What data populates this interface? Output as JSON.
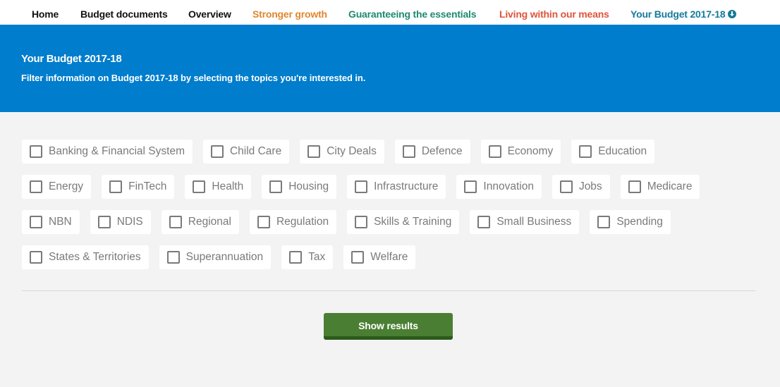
{
  "nav": {
    "items": [
      {
        "label": "Home",
        "color": "#111111"
      },
      {
        "label": "Budget documents",
        "color": "#111111"
      },
      {
        "label": "Overview",
        "color": "#111111"
      },
      {
        "label": "Stronger growth",
        "color": "#e1862c"
      },
      {
        "label": "Guaranteeing the essentials",
        "color": "#1e8a6e"
      },
      {
        "label": "Living within our means",
        "color": "#e0533a"
      },
      {
        "label": "Your Budget 2017-18",
        "color": "#157b9a",
        "icon": "download-circle-icon"
      }
    ]
  },
  "hero": {
    "title": "Your Budget 2017-18",
    "subtitle": "Filter information on Budget 2017-18 by selecting the topics you're interested in.",
    "background": "#007dcc"
  },
  "topics": {
    "rows": [
      [
        {
          "label": "Banking & Financial System",
          "checked": false
        },
        {
          "label": "Child Care",
          "checked": false
        },
        {
          "label": "City Deals",
          "checked": false
        },
        {
          "label": "Defence",
          "checked": false
        },
        {
          "label": "Economy",
          "checked": false
        },
        {
          "label": "Education",
          "checked": false
        }
      ],
      [
        {
          "label": "Energy",
          "checked": false
        },
        {
          "label": "FinTech",
          "checked": false
        },
        {
          "label": "Health",
          "checked": false
        },
        {
          "label": "Housing",
          "checked": false
        },
        {
          "label": "Infrastructure",
          "checked": false
        },
        {
          "label": "Innovation",
          "checked": false
        },
        {
          "label": "Jobs",
          "checked": false
        },
        {
          "label": "Medicare",
          "checked": false
        }
      ],
      [
        {
          "label": "NBN",
          "checked": false
        },
        {
          "label": "NDIS",
          "checked": false
        },
        {
          "label": "Regional",
          "checked": false
        },
        {
          "label": "Regulation",
          "checked": false
        },
        {
          "label": "Skills & Training",
          "checked": false
        },
        {
          "label": "Small Business",
          "checked": false
        },
        {
          "label": "Spending",
          "checked": false
        }
      ],
      [
        {
          "label": "States & Territories",
          "checked": false
        },
        {
          "label": "Superannuation",
          "checked": false
        },
        {
          "label": "Tax",
          "checked": false
        },
        {
          "label": "Welfare",
          "checked": false
        }
      ]
    ]
  },
  "actions": {
    "show_results_label": "Show results",
    "button_color": "#4a7f33"
  }
}
